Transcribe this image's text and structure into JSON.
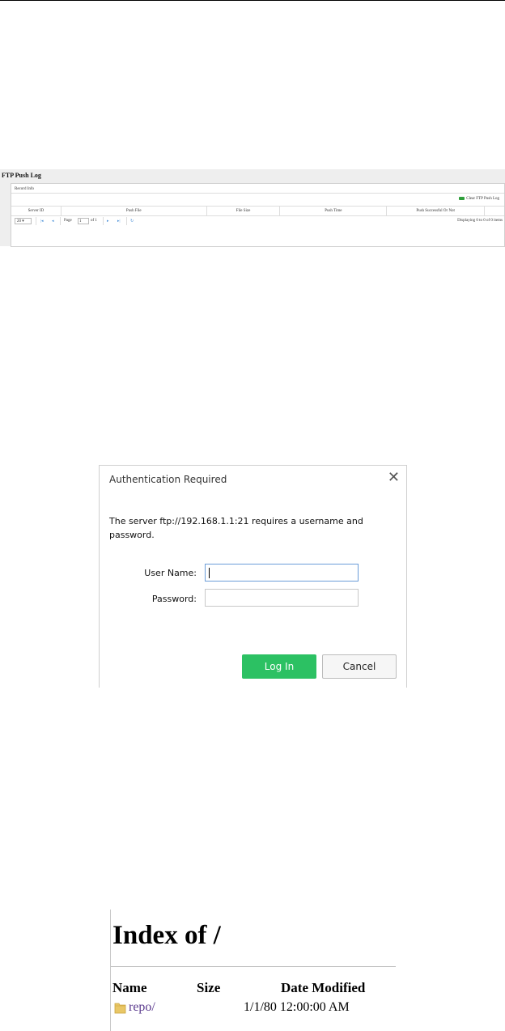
{
  "ftp_log": {
    "title": "FTP Push Log",
    "record_info": "Record Info",
    "clear_label": "Clear FTP Push Log",
    "columns": [
      "Server ID",
      "Push File",
      "File Size",
      "Push Time",
      "Push Successful Or Not"
    ],
    "page_size": "20 ▾",
    "page_label": "Page",
    "page_value": "1",
    "of_label": "of 1",
    "displaying": "Displaying 0 to 0 of 0 items"
  },
  "auth_dialog": {
    "title": "Authentication Required",
    "message": "The server ftp://192.168.1.1:21 requires a username and password.",
    "username_label": "User Name:",
    "password_label": "Password:",
    "username_value": "",
    "password_value": "",
    "login_label": "Log In",
    "cancel_label": "Cancel",
    "colors": {
      "login": "#2cc163"
    }
  },
  "index_page": {
    "heading": "Index of /",
    "columns": {
      "name": "Name",
      "size": "Size",
      "date": "Date Modified"
    },
    "rows": [
      {
        "name": "repo/",
        "size": "",
        "date": "1/1/80 12:00:00 AM",
        "icon": "folder-icon"
      }
    ]
  }
}
